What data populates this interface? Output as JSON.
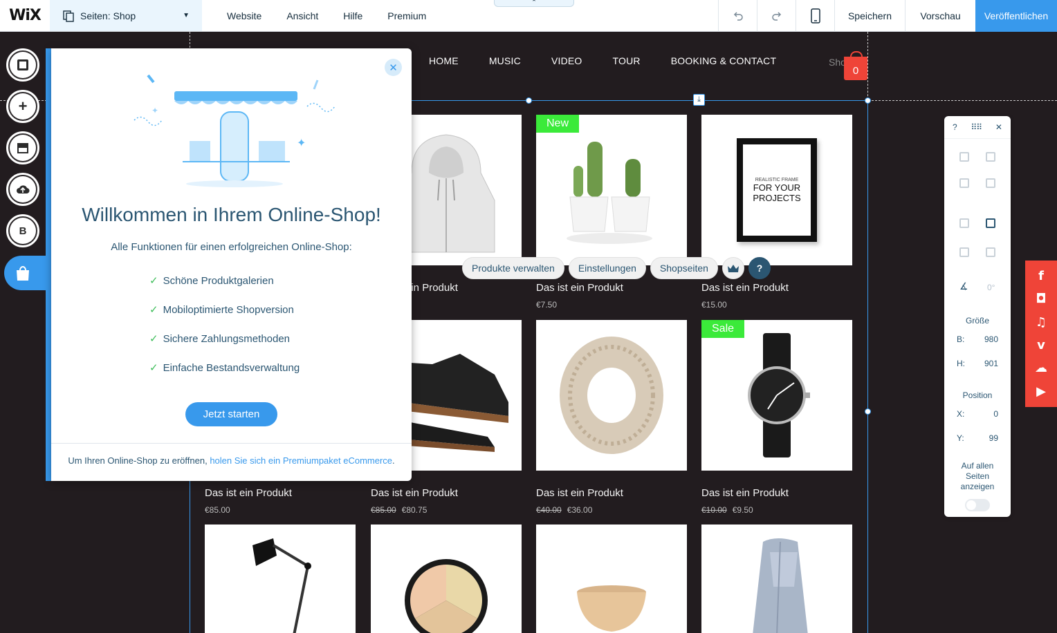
{
  "topbar": {
    "logo": "WiX",
    "pages_label": "Seiten: Shop",
    "menu": [
      "Website",
      "Ansicht",
      "Hilfe",
      "Premium"
    ],
    "save": "Speichern",
    "preview": "Vorschau",
    "publish": "Veröffentlichen"
  },
  "site": {
    "nav": [
      "HOME",
      "MUSIC",
      "VIDEO",
      "TOUR",
      "BOOKING & CONTACT"
    ],
    "shop_partial": "Sho",
    "cart_count": "0"
  },
  "products": [
    {
      "name": "Das ist ein Produkt",
      "price": "",
      "old_price": "",
      "ribbon": ""
    },
    {
      "name": "Das ist ein Produkt",
      "price": "€7.50",
      "old_price": "",
      "ribbon": "New"
    },
    {
      "name": "Das ist ein Produkt",
      "price": "€15.00",
      "old_price": "",
      "ribbon": ""
    },
    {
      "name": "Das ist ein Produkt",
      "price": "€85.00",
      "old_price": "",
      "ribbon": ""
    },
    {
      "name": "Das ist ein Produkt",
      "price": "€80.75",
      "old_price": "€85.00",
      "ribbon": ""
    },
    {
      "name": "Das ist ein Produkt",
      "price": "€36.00",
      "old_price": "€40.00",
      "ribbon": ""
    },
    {
      "name": "Das ist ein Produkt",
      "price": "€9.50",
      "old_price": "€10.00",
      "ribbon": "Sale"
    }
  ],
  "frame_text": [
    "REALISTIC FRAME",
    "FOR YOUR",
    "PROJECTS"
  ],
  "gallery_toolbar": {
    "manage": "Produkte verwalten",
    "settings": "Einstellungen",
    "shop_pages": "Shopseiten",
    "help": "?"
  },
  "welcome": {
    "title": "Willkommen in Ihrem Online-Shop!",
    "subtitle": "Alle Funktionen für einen erfolgreichen Online-Shop:",
    "features": [
      "Schöne Produktgalerien",
      "Mobiloptimierte Shopversion",
      "Sichere Zahlungsmethoden",
      "Einfache Bestandsverwaltung"
    ],
    "cta": "Jetzt starten",
    "footer_text": "Um Ihren Online-Shop zu eröffnen,",
    "footer_link": "holen Sie sich ein Premiumpaket eCommerce",
    "footer_end": "."
  },
  "inspector": {
    "help": "?",
    "angle": "0°",
    "size_label": "Größe",
    "w_label": "B:",
    "w_value": "980",
    "h_label": "H:",
    "h_value": "901",
    "position_label": "Position",
    "x_label": "X:",
    "x_value": "0",
    "y_label": "Y:",
    "y_value": "99",
    "show_all": "Auf allen Seiten anzeigen"
  },
  "colors": {
    "accent": "#3899ec",
    "canvas": "#221c1f",
    "ribbon": "#3bea3a",
    "social": "#ef4438"
  }
}
